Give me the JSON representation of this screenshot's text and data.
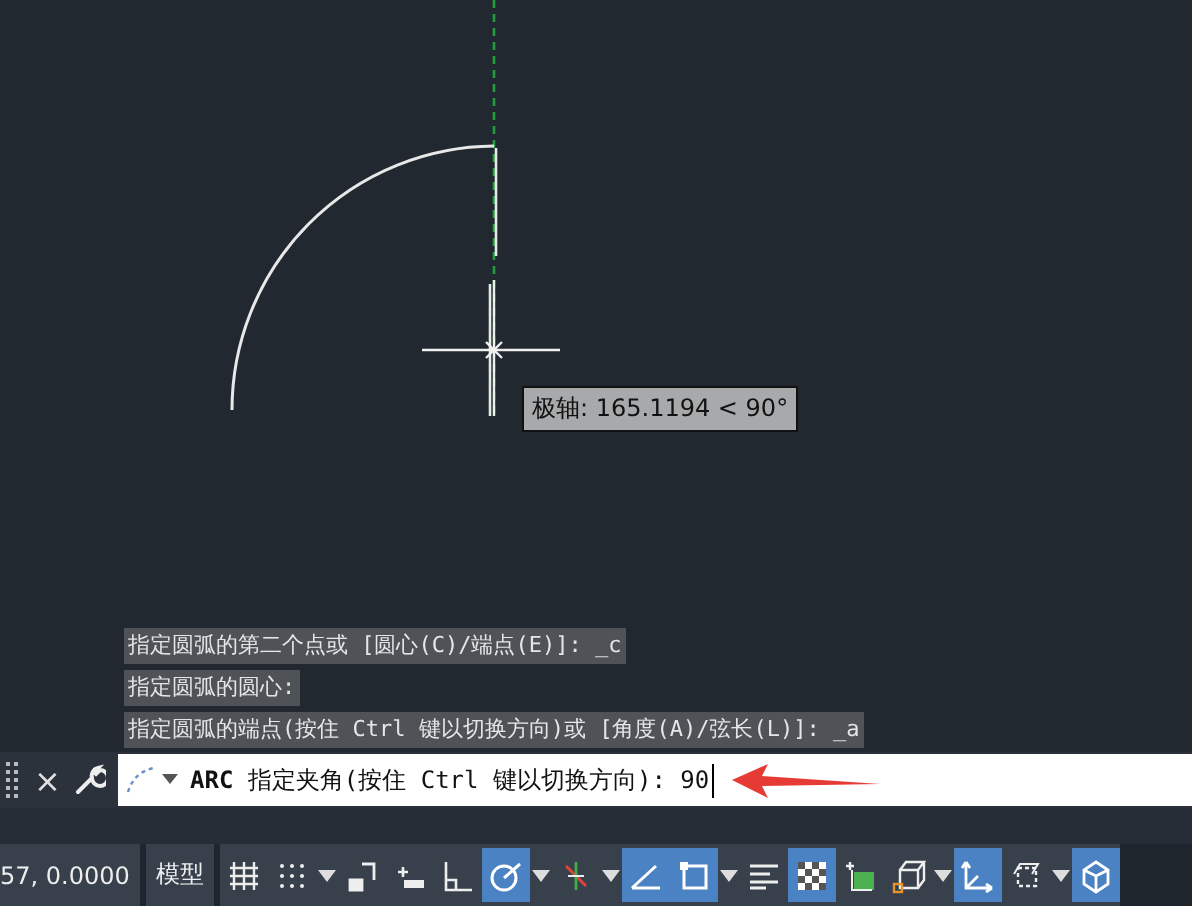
{
  "drawing": {
    "tooltip": "极轴: 165.1194 < 90°"
  },
  "command_history": [
    "指定圆弧的第二个点或 [圆心(C)/端点(E)]: _c",
    "指定圆弧的圆心:",
    "指定圆弧的端点(按住 Ctrl 键以切换方向)或 [角度(A)/弦长(L)]: _a"
  ],
  "command_line": {
    "close": "×",
    "value": "**ARC** 指定夹角(按住 Ctrl 键以切换方向): 90"
  },
  "status_bar": {
    "coordinates": "57, 0.0000",
    "model_tab": "模型",
    "buttons": [
      {
        "kind": "grid",
        "on": false,
        "caret": false
      },
      {
        "kind": "snap",
        "on": false,
        "caret": true
      },
      {
        "kind": "infer",
        "on": false,
        "caret": false
      },
      {
        "kind": "dynin",
        "on": false,
        "caret": false
      },
      {
        "kind": "ortho",
        "on": false,
        "caret": false
      },
      {
        "kind": "polar",
        "on": true,
        "caret": true
      },
      {
        "kind": "isoplane",
        "on": false,
        "caret": true
      },
      {
        "kind": "tracking",
        "on": true,
        "caret": false
      },
      {
        "kind": "osnap",
        "on": true,
        "caret": true
      },
      {
        "kind": "lineweight",
        "on": false,
        "caret": false
      },
      {
        "kind": "transparency",
        "on": true,
        "caret": false
      },
      {
        "kind": "cycling",
        "on": false,
        "caret": false
      },
      {
        "kind": "osnap3d",
        "on": false,
        "caret": true
      },
      {
        "kind": "ducs",
        "on": true,
        "caret": false
      },
      {
        "kind": "filter",
        "on": false,
        "caret": true
      },
      {
        "kind": "gizmo",
        "on": true,
        "caret": false
      }
    ]
  }
}
